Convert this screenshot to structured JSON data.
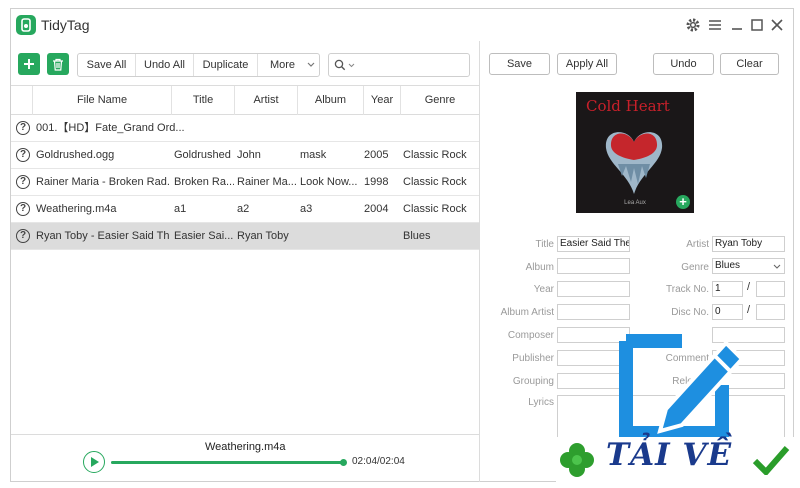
{
  "app": {
    "title": "TidyTag"
  },
  "toolbar": {
    "add_icon": "plus-icon",
    "delete_icon": "trash-icon",
    "save_all": "Save All",
    "undo_all": "Undo All",
    "duplicate": "Duplicate",
    "more": "More",
    "search_placeholder": ""
  },
  "table": {
    "columns": [
      "File Name",
      "Title",
      "Artist",
      "Album",
      "Year",
      "Genre"
    ],
    "rows": [
      {
        "file": "001.【HD】Fate_Grand Ord...",
        "title": "",
        "artist": "",
        "album": "",
        "year": "",
        "genre": ""
      },
      {
        "file": "Goldrushed.ogg",
        "title": "Goldrushed",
        "artist": "John",
        "album": "mask",
        "year": "2005",
        "genre": "Classic Rock"
      },
      {
        "file": "Rainer Maria - Broken Rad...",
        "title": "Broken Ra...",
        "artist": "Rainer Ma...",
        "album": "Look Now...",
        "year": "1998",
        "genre": "Classic Rock"
      },
      {
        "file": "Weathering.m4a",
        "title": "a1",
        "artist": "a2",
        "album": "a3",
        "year": "2004",
        "genre": "Classic Rock"
      },
      {
        "file": "Ryan Toby - Easier Said Th...",
        "title": "Easier Sai...",
        "artist": "Ryan Toby",
        "album": "",
        "year": "",
        "genre": "Blues",
        "selected": true
      }
    ]
  },
  "player": {
    "file": "Weathering.m4a",
    "time": "02:04/02:04",
    "progress": 1.0
  },
  "editor": {
    "save": "Save",
    "apply_all": "Apply All",
    "undo": "Undo",
    "clear": "Clear",
    "cover": {
      "title": "Cold Heart",
      "artist": "Lea Aux"
    },
    "labels": {
      "title": "Title",
      "artist": "Artist",
      "album": "Album",
      "genre": "Genre",
      "year": "Year",
      "track": "Track No.",
      "album_artist": "Album Artist",
      "disc": "Disc No.",
      "composer": "Composer",
      "publisher": "Publisher",
      "comment": "Comment",
      "grouping": "Grouping",
      "release": "Release",
      "lyrics": "Lyrics"
    },
    "values": {
      "title": "Easier Said Ther",
      "artist": "Ryan Toby",
      "album": "",
      "genre": "Blues",
      "year": "",
      "track": "1",
      "track_total": "",
      "album_artist": "",
      "disc": "0",
      "disc_total": "",
      "composer": "",
      "publisher": "",
      "comment": "",
      "grouping": "",
      "release": "",
      "lyrics": ""
    },
    "slash": "/"
  },
  "watermark": {
    "text": "TẢI VỀ"
  },
  "colors": {
    "accent": "#27a85e",
    "selected_row": "#dcdcdc",
    "watermark_blue": "#1e8fe0"
  }
}
